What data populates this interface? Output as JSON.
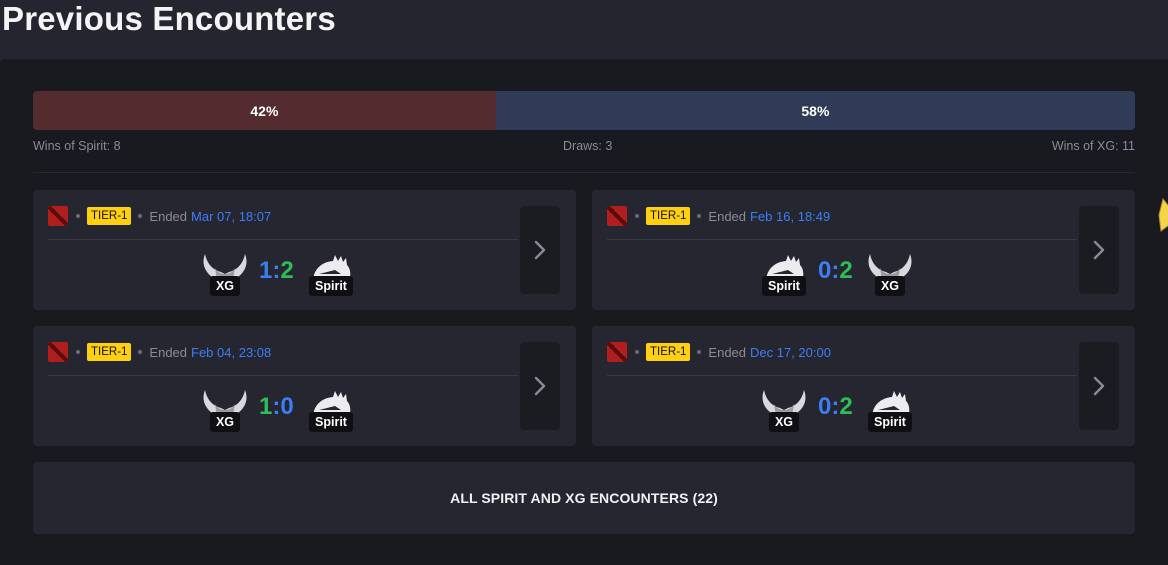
{
  "page_title": "Previous Encounters",
  "ratio": {
    "left_percent": 42,
    "right_percent": 58,
    "left_label": "42%",
    "right_label": "58%",
    "left_color": "#542c30",
    "right_color": "#2f3b57"
  },
  "stats": {
    "left": "Wins of Spirit: 8",
    "center": "Draws: 3",
    "right": "Wins of XG: 11"
  },
  "colors": {
    "win": "#2ebd59",
    "loss": "#3b7ef6",
    "tier_badge": "#ffd010",
    "date": "#3b7ef6"
  },
  "matches": [
    {
      "tier": "TIER-1",
      "ended_label": "Ended",
      "date": "Mar 07, 18:07",
      "team_left": "XG",
      "team_right": "Spirit",
      "score_left": "1",
      "score_sep": ":",
      "score_right": "2",
      "left_icon": "xg-horns-icon",
      "right_icon": "spirit-tiger-icon"
    },
    {
      "tier": "TIER-1",
      "ended_label": "Ended",
      "date": "Feb 16, 18:49",
      "team_left": "Spirit",
      "team_right": "XG",
      "score_left": "0",
      "score_sep": ":",
      "score_right": "2",
      "left_icon": "spirit-tiger-icon",
      "right_icon": "xg-horns-icon"
    },
    {
      "tier": "TIER-1",
      "ended_label": "Ended",
      "date": "Feb 04, 23:08",
      "team_left": "XG",
      "team_right": "Spirit",
      "score_left": "1",
      "score_sep": ":",
      "score_right": "0",
      "left_icon": "xg-horns-icon",
      "right_icon": "spirit-tiger-icon"
    },
    {
      "tier": "TIER-1",
      "ended_label": "Ended",
      "date": "Dec 17, 20:00",
      "team_left": "XG",
      "team_right": "Spirit",
      "score_left": "0",
      "score_sep": ":",
      "score_right": "2",
      "left_icon": "xg-horns-icon",
      "right_icon": "spirit-tiger-icon"
    }
  ],
  "all_encounters_label": "ALL SPIRIT AND XG ENCOUNTERS (22)"
}
